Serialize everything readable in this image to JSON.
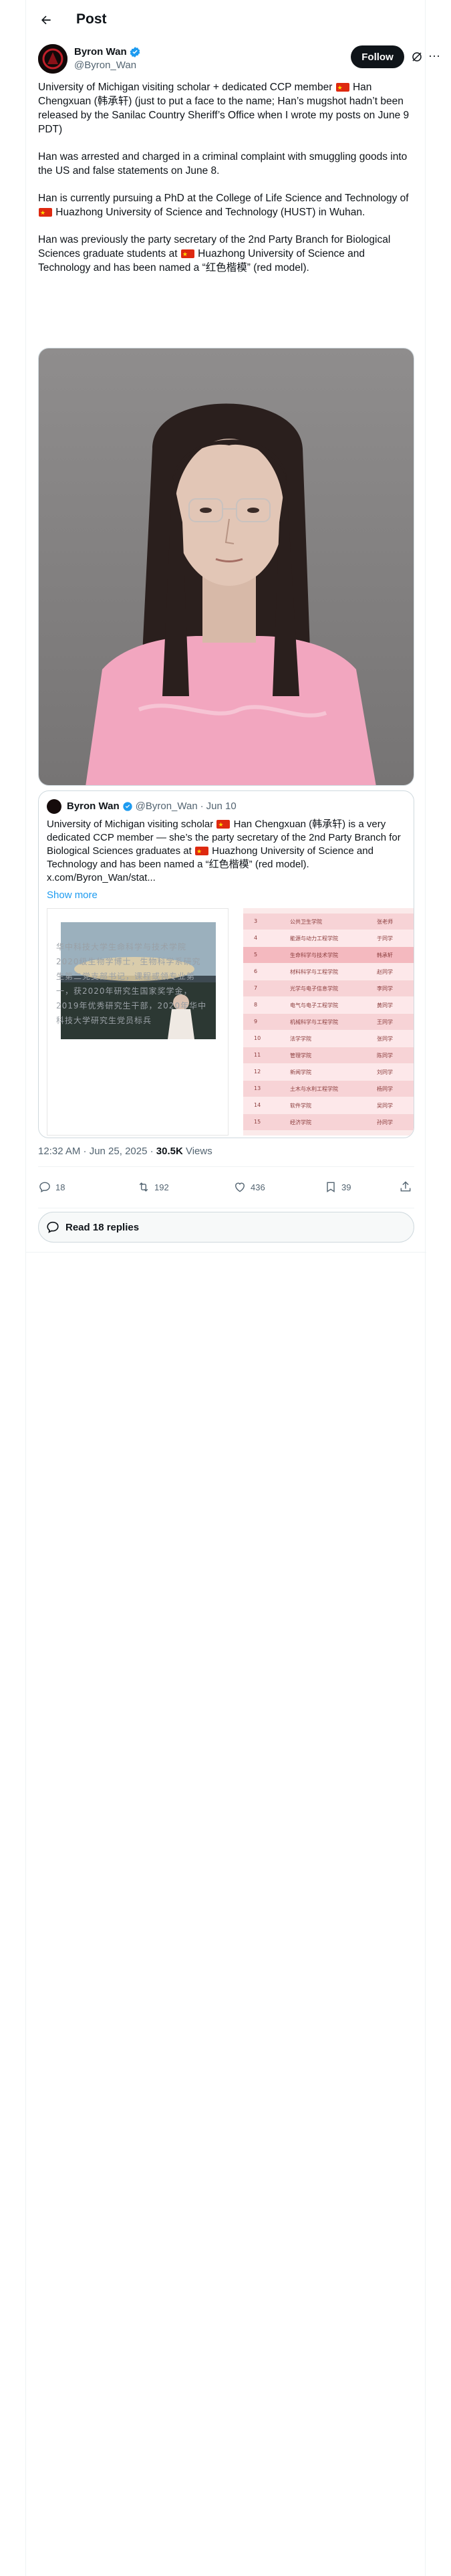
{
  "header": {
    "title": "Post",
    "back_icon": "arrow-left-icon"
  },
  "author": {
    "name": "Byron Wan",
    "handle": "@Byron_Wan",
    "verified": true,
    "follow_label": "Follow",
    "more_label": "···"
  },
  "post": {
    "paragraphs": [
      {
        "parts": [
          "University of Michigan visiting scholar + dedicated CCP member ",
          "🇨🇳",
          " Han Chengxuan (韩承轩) (just to put a face to the name; Han’s mugshot hadn’t been released by the Sanilac Country Sheriff’s Office when I wrote my posts on June 9 PDT)"
        ]
      },
      {
        "parts": [
          "Han was arrested and charged in a criminal complaint with smuggling goods into the US and false statements on June 8."
        ]
      },
      {
        "parts": [
          "Han is currently pursuing a PhD at the College of Life Science and Technology of ",
          "🇨🇳",
          " Huazhong University of Science and Technology (HUST) in Wuhan."
        ]
      },
      {
        "parts": [
          "Han was previously the party secretary of the 2nd Party Branch for Biological Sciences graduate students at ",
          "🇨🇳",
          " Huazhong University of Science and Technology and has been named a “红色楷模” (red model)."
        ]
      }
    ]
  },
  "quote": {
    "name": "Byron Wan",
    "handle": "@Byron_Wan",
    "date": "Jun 10",
    "text_1": "University of Michigan visiting scholar ",
    "text_2": " Han Chengxuan (韩承轩) is a very dedicated CCP member — she’s the party secretary of the 2nd Party Branch for Biological Sciences graduates at ",
    "text_3": " Huazhong University of Science and Technology and has been named a “红色楷模” (red model).",
    "link": "x.com/Byron_Wan/stat...",
    "show_more": "Show more",
    "cn_text": "华中科技大学生命科学与技术学院2020级生物学博士，生物科学系研究生第二党支部书记，课程或领专业第一，获2020年研究生国家奖学金，2019年优秀研究生干部，2020年华中科技大学研究生党员标兵"
  },
  "ranking_rows": [
    {
      "num": "3",
      "unit": "公共卫生学院",
      "name": "张老师"
    },
    {
      "num": "4",
      "unit": "能源与动力工程学院",
      "name": "于同学"
    },
    {
      "num": "5",
      "unit": "生命科学与技术学院",
      "name": "韩承轩"
    },
    {
      "num": "6",
      "unit": "材料科学与工程学院",
      "name": "赵同学"
    },
    {
      "num": "7",
      "unit": "光学与电子信息学院",
      "name": "李同学"
    },
    {
      "num": "8",
      "unit": "电气与电子工程学院",
      "name": "黄同学"
    },
    {
      "num": "9",
      "unit": "机械科学与工程学院",
      "name": "王同学"
    },
    {
      "num": "10",
      "unit": "法学学院",
      "name": "张同学"
    },
    {
      "num": "11",
      "unit": "管理学院",
      "name": "陈同学"
    },
    {
      "num": "12",
      "unit": "新闻学院",
      "name": "刘同学"
    },
    {
      "num": "13",
      "unit": "土木与水利工程学院",
      "name": "杨同学"
    },
    {
      "num": "14",
      "unit": "软件学院",
      "name": "吴同学"
    },
    {
      "num": "15",
      "unit": "经济学院",
      "name": "孙同学"
    }
  ],
  "meta": {
    "time": "12:32 AM · Jun 25, 2025 · ",
    "views": "30.5K",
    "views_label": " Views"
  },
  "actions": {
    "replies": "18",
    "reposts": "192",
    "likes": "436",
    "bookmarks": "39"
  },
  "read_replies": "Read 18 replies",
  "colors": {
    "accent": "#1d9bf0",
    "text": "#0f1419",
    "muted": "#536471",
    "flag": "#de2910"
  }
}
